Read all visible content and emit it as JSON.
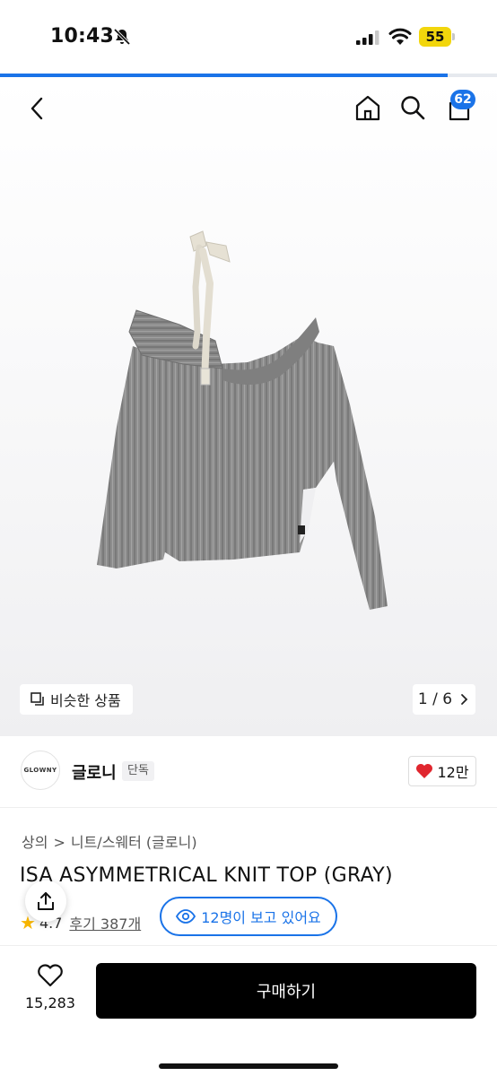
{
  "status_bar": {
    "time": "10:43",
    "battery": "55"
  },
  "page_progress": 0.9,
  "nav": {
    "cart_count": "62"
  },
  "gallery": {
    "similar_label": "비슷한 상품",
    "counter": "1 / 6"
  },
  "brand": {
    "logo_text": "GLOWNY",
    "name": "글로니",
    "tag": "단독",
    "likes": "12만"
  },
  "breadcrumb": [
    "상의",
    "니트/스웨터 (글로니)"
  ],
  "product": {
    "title": "ISA ASYMMETRICAL KNIT TOP (GRAY)",
    "rating": "4.7",
    "reviews": "후기 387개",
    "viewers": "12명이 보고 있어요"
  },
  "bottom_bar": {
    "wish_count": "15,283",
    "buy_label": "구매하기"
  },
  "colors": {
    "accent": "#1a73e8",
    "battery": "#f2d60c",
    "heart": "#e0262e"
  }
}
